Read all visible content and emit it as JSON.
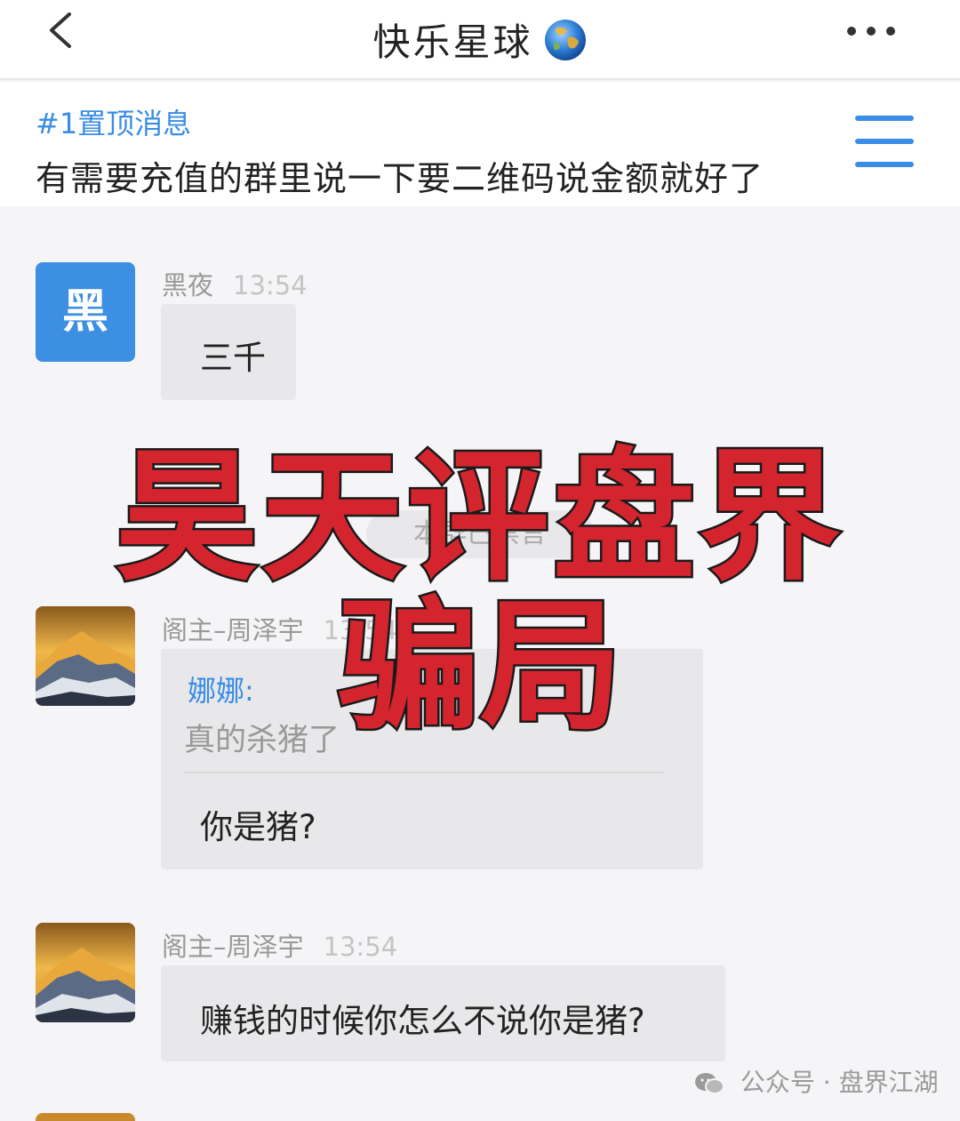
{
  "header": {
    "title": "快乐星球",
    "title_icon": "globe-emoji",
    "back_icon": "chevron-left-icon",
    "more_icon": "more-dots-icon"
  },
  "pinned": {
    "title": "#1置顶消息",
    "text": "有需要充值的群里说一下要二维码说金额就好了",
    "menu_icon": "hamburger-menu-icon"
  },
  "messages": [
    {
      "sender": "黑夜",
      "time": "13:54",
      "avatar_letter": "黑",
      "text": "三千"
    },
    {
      "sender": "阁主–周泽宇",
      "time": "13:54",
      "quote_name": "娜娜:",
      "quote_text": "真的杀猪了",
      "text": "你是猪?"
    },
    {
      "sender": "阁主–周泽宇",
      "time": "13:54",
      "text": "赚钱的时候你怎么不说你是猪?"
    }
  ],
  "notice": "本群已禁言",
  "overlay": {
    "line1": "昊天评盘界",
    "line2": "骗局"
  },
  "watermark": "公众号 · 盘界江湖",
  "colors": {
    "accent": "#3a8ce6",
    "overlay_red": "#d4252f",
    "bubble": "#e8e8ea"
  }
}
